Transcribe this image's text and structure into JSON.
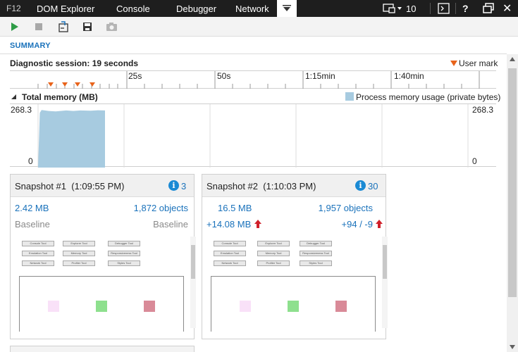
{
  "tabs": {
    "f12": "F12",
    "items": [
      "DOM Explorer",
      "Console",
      "Debugger",
      "Network"
    ],
    "emulation_count": "10",
    "help": "?",
    "close": "✕"
  },
  "toolbar": {
    "icons": [
      "play-icon",
      "stop-icon",
      "import-icon",
      "save-icon",
      "camera-icon"
    ]
  },
  "summary": {
    "heading": "SUMMARY",
    "session": "Diagnostic session: 19 seconds",
    "user_mark": "User mark",
    "ruler_labels": [
      "25s",
      "50s",
      "1:15min",
      "1:40min"
    ]
  },
  "memory_chart": {
    "title": "Total memory (MB)",
    "legend": "Process memory usage (private bytes)",
    "y_max_label": "268.3",
    "y_min_label": "0",
    "y_max_right_label": "268.3",
    "y_min_right_label": "0",
    "color": "#a7cbe0"
  },
  "chart_data": {
    "type": "area",
    "title": "Total memory (MB)",
    "ylabel": "",
    "ylim": [
      0,
      268.3
    ],
    "series": [
      {
        "name": "Process memory usage (private bytes)",
        "x": [
          0,
          0.5,
          1,
          3,
          5,
          8,
          10,
          12,
          15,
          17,
          19
        ],
        "values": [
          0,
          240,
          252,
          248,
          246,
          250,
          248,
          250,
          249,
          251,
          250
        ]
      }
    ],
    "x_tick_labels": [
      "25s",
      "50s",
      "1:15min",
      "1:40min"
    ],
    "user_marks_seconds": [
      2,
      5,
      8,
      10
    ]
  },
  "snapshots": [
    {
      "title": "Snapshot #1",
      "time": "(1:09:55 PM)",
      "info_count": "3",
      "size": "2.42 MB",
      "objects": "1,872 objects",
      "size_diff": "Baseline",
      "objects_diff": "Baseline",
      "thumb_buttons": [
        "Console Tool",
        "Explorer Tool",
        "Debugger Tool",
        "Emulation Tool",
        "Memory Tool",
        "Responsiveness Tool",
        "Network Tool",
        "Profiler Tool",
        "Styles Tool"
      ]
    },
    {
      "title": "Snapshot #2",
      "time": "(1:10:03 PM)",
      "info_count": "30",
      "size": "16.5 MB",
      "objects": "1,957 objects",
      "size_diff": "+14.08 MB",
      "objects_diff": "+94 / -9",
      "thumb_buttons": [
        "Console Tool",
        "Explorer Tool",
        "Debugger Tool",
        "Emulation Tool",
        "Memory Tool",
        "Responsiveness Tool",
        "Network Tool",
        "Profiler Tool",
        "Styles Tool"
      ]
    }
  ],
  "colors": {
    "accent": "#1a72bb",
    "increase": "#d0202a",
    "user_mark": "#e8631a",
    "square_pink": "#f9e1f8",
    "square_green": "#8ee08e",
    "square_red": "#d98a98"
  }
}
